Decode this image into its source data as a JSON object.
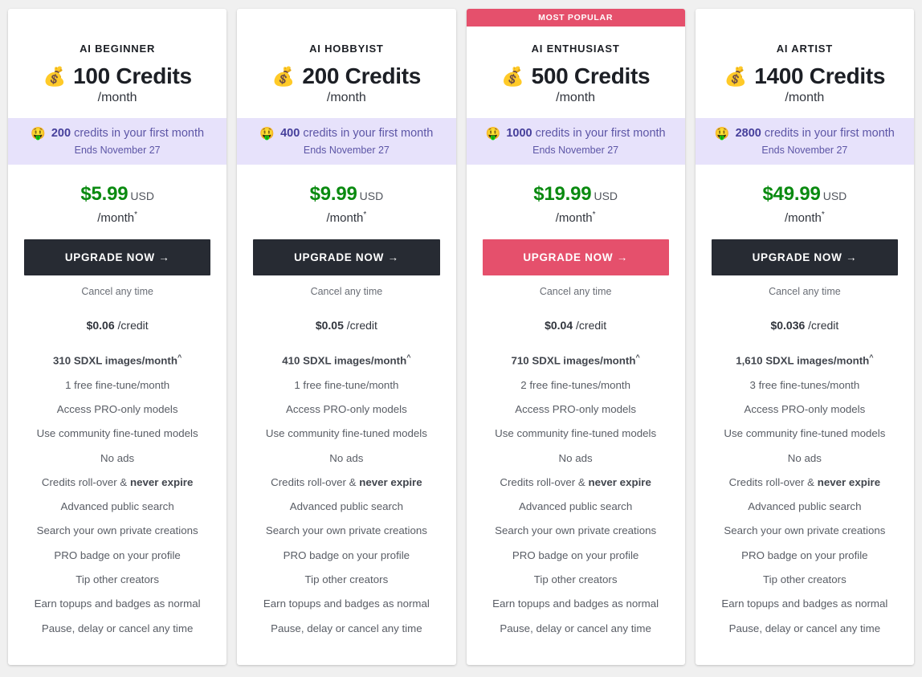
{
  "background_color": "#f0f0f0",
  "accent_color": "#e5506c",
  "price_color": "#0a8a10",
  "promo_bg_color": "#e7e2fb",
  "promo_text_color": "#5d56a6",
  "cta_dark_color": "#272b33",
  "icons": {
    "money_bag": "💰",
    "money_mouth_face": "🤑",
    "arrow_right": "→"
  },
  "common": {
    "credits_period": "/month",
    "promo_suffix": "credits in your first month",
    "promo_ends": "Ends November 27",
    "currency": "USD",
    "price_period": "/month",
    "price_asterisk": "*",
    "cta_label": "UPGRADE NOW",
    "cancel_note": "Cancel any time",
    "per_credit_unit": "/credit",
    "most_popular_label": "MOST POPULAR"
  },
  "plans": [
    {
      "name": "AI BEGINNER",
      "credits": "100 Credits",
      "credits_period": "/month",
      "promo_bonus": "200",
      "promo_text": "credits in your first month",
      "promo_ends": "Ends November 27",
      "price": "$5.99",
      "currency": "USD",
      "price_period": "/month",
      "cta_label": "UPGRADE NOW",
      "cancel_note": "Cancel any time",
      "per_credit_amount": "$0.06",
      "per_credit_unit": "/credit",
      "most_popular": false,
      "features": [
        {
          "text": "310 SDXL images/month",
          "bold": true,
          "caret": true
        },
        {
          "text": "1 free fine-tune/month",
          "bold": false,
          "caret": false
        },
        {
          "text": "Access PRO-only models",
          "bold": false,
          "caret": false
        },
        {
          "text": "Use community fine-tuned models",
          "bold": false,
          "caret": false
        },
        {
          "text": "No ads",
          "bold": false,
          "caret": false
        },
        {
          "text": "Credits roll-over & ",
          "bold": false,
          "caret": false,
          "trailing_bold": "never expire"
        },
        {
          "text": "Advanced public search",
          "bold": false,
          "caret": false
        },
        {
          "text": "Search your own private creations",
          "bold": false,
          "caret": false
        },
        {
          "text": "PRO badge on your profile",
          "bold": false,
          "caret": false
        },
        {
          "text": "Tip other creators",
          "bold": false,
          "caret": false
        },
        {
          "text": "Earn topups and badges as normal",
          "bold": false,
          "caret": false
        },
        {
          "text": "Pause, delay or cancel any time",
          "bold": false,
          "caret": false
        }
      ]
    },
    {
      "name": "AI HOBBYIST",
      "credits": "200 Credits",
      "credits_period": "/month",
      "promo_bonus": "400",
      "promo_text": "credits in your first month",
      "promo_ends": "Ends November 27",
      "price": "$9.99",
      "currency": "USD",
      "price_period": "/month",
      "cta_label": "UPGRADE NOW",
      "cancel_note": "Cancel any time",
      "per_credit_amount": "$0.05",
      "per_credit_unit": "/credit",
      "most_popular": false,
      "features": [
        {
          "text": "410 SDXL images/month",
          "bold": true,
          "caret": true
        },
        {
          "text": "1 free fine-tune/month",
          "bold": false,
          "caret": false
        },
        {
          "text": "Access PRO-only models",
          "bold": false,
          "caret": false
        },
        {
          "text": "Use community fine-tuned models",
          "bold": false,
          "caret": false
        },
        {
          "text": "No ads",
          "bold": false,
          "caret": false
        },
        {
          "text": "Credits roll-over & ",
          "bold": false,
          "caret": false,
          "trailing_bold": "never expire"
        },
        {
          "text": "Advanced public search",
          "bold": false,
          "caret": false
        },
        {
          "text": "Search your own private creations",
          "bold": false,
          "caret": false
        },
        {
          "text": "PRO badge on your profile",
          "bold": false,
          "caret": false
        },
        {
          "text": "Tip other creators",
          "bold": false,
          "caret": false
        },
        {
          "text": "Earn topups and badges as normal",
          "bold": false,
          "caret": false
        },
        {
          "text": "Pause, delay or cancel any time",
          "bold": false,
          "caret": false
        }
      ]
    },
    {
      "name": "AI ENTHUSIAST",
      "credits": "500 Credits",
      "credits_period": "/month",
      "promo_bonus": "1000",
      "promo_text": "credits in your first month",
      "promo_ends": "Ends November 27",
      "price": "$19.99",
      "currency": "USD",
      "price_period": "/month",
      "cta_label": "UPGRADE NOW",
      "cancel_note": "Cancel any time",
      "per_credit_amount": "$0.04",
      "per_credit_unit": "/credit",
      "most_popular": true,
      "most_popular_label": "MOST POPULAR",
      "features": [
        {
          "text": "710 SDXL images/month",
          "bold": true,
          "caret": true
        },
        {
          "text": "2 free fine-tunes/month",
          "bold": false,
          "caret": false
        },
        {
          "text": "Access PRO-only models",
          "bold": false,
          "caret": false
        },
        {
          "text": "Use community fine-tuned models",
          "bold": false,
          "caret": false
        },
        {
          "text": "No ads",
          "bold": false,
          "caret": false
        },
        {
          "text": "Credits roll-over & ",
          "bold": false,
          "caret": false,
          "trailing_bold": "never expire"
        },
        {
          "text": "Advanced public search",
          "bold": false,
          "caret": false
        },
        {
          "text": "Search your own private creations",
          "bold": false,
          "caret": false
        },
        {
          "text": "PRO badge on your profile",
          "bold": false,
          "caret": false
        },
        {
          "text": "Tip other creators",
          "bold": false,
          "caret": false
        },
        {
          "text": "Earn topups and badges as normal",
          "bold": false,
          "caret": false
        },
        {
          "text": "Pause, delay or cancel any time",
          "bold": false,
          "caret": false
        }
      ]
    },
    {
      "name": "AI ARTIST",
      "credits": "1400 Credits",
      "credits_period": "/month",
      "promo_bonus": "2800",
      "promo_text": "credits in your first month",
      "promo_ends": "Ends November 27",
      "price": "$49.99",
      "currency": "USD",
      "price_period": "/month",
      "cta_label": "UPGRADE NOW",
      "cancel_note": "Cancel any time",
      "per_credit_amount": "$0.036",
      "per_credit_unit": "/credit",
      "most_popular": false,
      "features": [
        {
          "text": "1,610 SDXL images/month",
          "bold": true,
          "caret": true
        },
        {
          "text": "3 free fine-tunes/month",
          "bold": false,
          "caret": false
        },
        {
          "text": "Access PRO-only models",
          "bold": false,
          "caret": false
        },
        {
          "text": "Use community fine-tuned models",
          "bold": false,
          "caret": false
        },
        {
          "text": "No ads",
          "bold": false,
          "caret": false
        },
        {
          "text": "Credits roll-over & ",
          "bold": false,
          "caret": false,
          "trailing_bold": "never expire"
        },
        {
          "text": "Advanced public search",
          "bold": false,
          "caret": false
        },
        {
          "text": "Search your own private creations",
          "bold": false,
          "caret": false
        },
        {
          "text": "PRO badge on your profile",
          "bold": false,
          "caret": false
        },
        {
          "text": "Tip other creators",
          "bold": false,
          "caret": false
        },
        {
          "text": "Earn topups and badges as normal",
          "bold": false,
          "caret": false
        },
        {
          "text": "Pause, delay or cancel any time",
          "bold": false,
          "caret": false
        }
      ]
    }
  ]
}
